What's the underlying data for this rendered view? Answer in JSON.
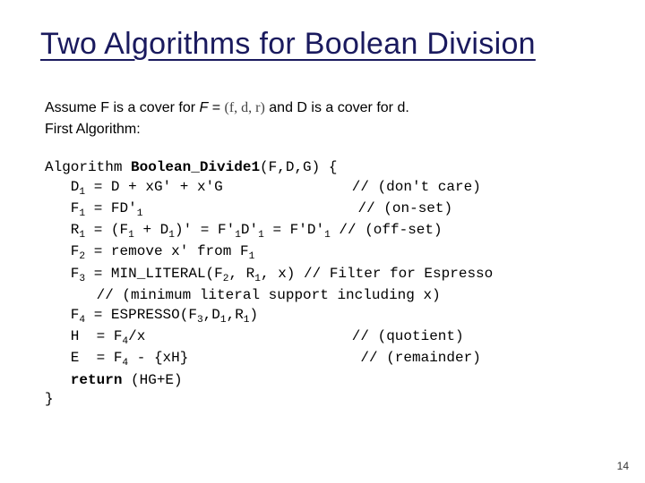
{
  "title": "Two Algorithms for Boolean Division",
  "intro": {
    "line1_a": "Assume F is a cover for ",
    "line1_b": "F",
    "line1_c": " = ",
    "line1_d": "(f, d, r)",
    "line1_e": " and D is a cover for d.",
    "line2": "First Algorithm:"
  },
  "algo": {
    "sig_a": "Algorithm ",
    "sig_b": "Boolean_Divide1",
    "sig_c": "(F,D,G) {",
    "d1_a": "   D",
    "d1_b": " = D + xG' + x'G               // (don't care)",
    "f1_a": "   F",
    "f1_b": " = FD'",
    "f1_c": "                         // (on-set)",
    "r1_a": "   R",
    "r1_b": " = (F",
    "r1_c": " + D",
    "r1_d": ")' = F'",
    "r1_e": "D'",
    "r1_f": " = F'D'",
    "r1_g": " // (off-set)",
    "f2_a": "   F",
    "f2_b": " = remove x' from F",
    "f3_a": "   F",
    "f3_b": " = MIN_LITERAL(F",
    "f3_c": ", R",
    "f3_d": ", x) // Filter for Espresso",
    "f3_e": "      // (minimum literal support including x)",
    "f4_a": "   F",
    "f4_b": " = ESPRESSO(F",
    "f4_c": ",D",
    "f4_d": ",R",
    "f4_e": ")",
    "h_a": "   H  = F",
    "h_b": "/x                        // (quotient)",
    "e_a": "   E  = F",
    "e_b": " - {xH}                    // (remainder)",
    "ret": "   return",
    "ret2": " (HG+E)",
    "close": "}"
  },
  "pagenum": "14"
}
